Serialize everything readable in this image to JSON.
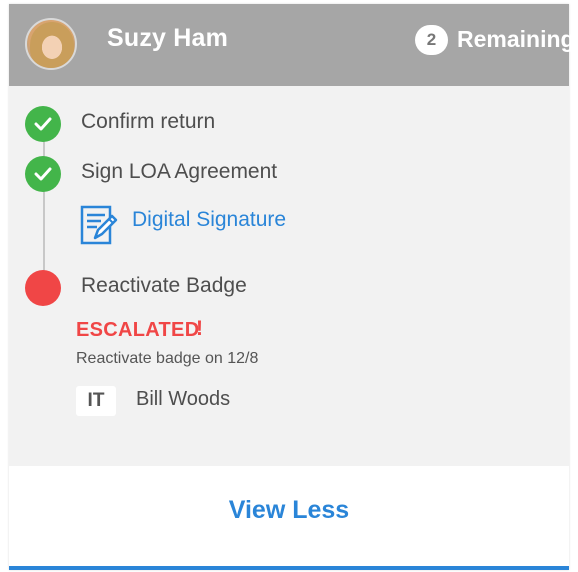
{
  "header": {
    "user_name": "Suzy Ham",
    "remaining_count": "2",
    "remaining_label": "Remaining"
  },
  "steps": [
    {
      "label": "Confirm return",
      "status": "done"
    },
    {
      "label": "Sign LOA Agreement",
      "status": "done",
      "action": {
        "label": "Digital Signature",
        "icon": "signature-doc-icon"
      }
    },
    {
      "label": "Reactivate Badge",
      "status": "escalated"
    }
  ],
  "escalation": {
    "label": "ESCALATED",
    "mark": "!",
    "detail": "Reactivate badge on 12/8",
    "department": "IT",
    "assignee": "Bill Woods"
  },
  "footer": {
    "toggle_label": "View Less"
  },
  "colors": {
    "header_bg": "#a6a6a6",
    "done": "#43b54a",
    "escalated": "#f04646",
    "link": "#2a85d8"
  }
}
